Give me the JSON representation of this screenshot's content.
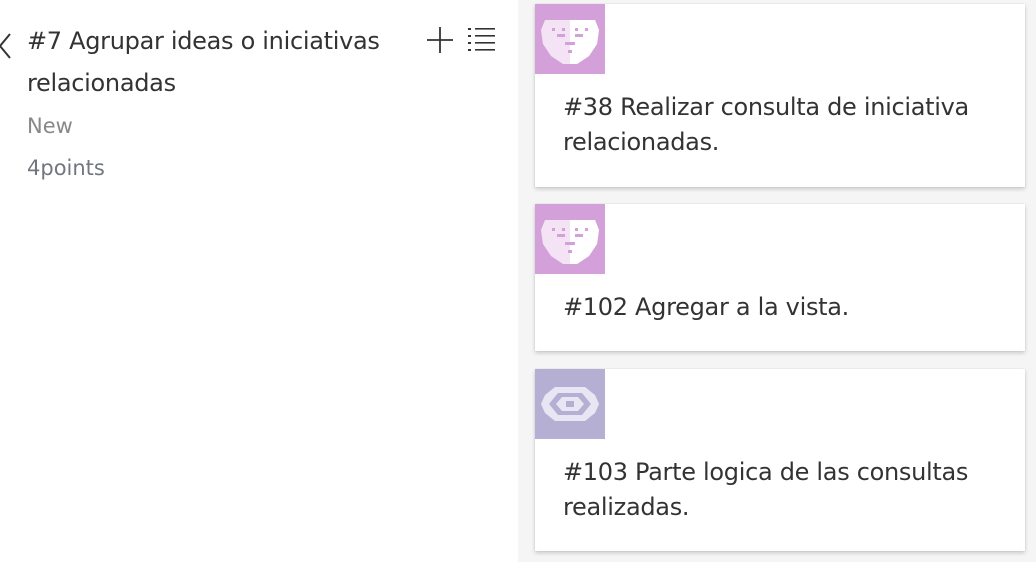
{
  "story": {
    "title": "#7 Agrupar ideas o iniciativas relacionadas",
    "state": "New",
    "points": "4points",
    "actions": {
      "collapse_icon": "chevron-left-icon",
      "add_icon": "plus-icon",
      "list_icon": "list-icon"
    }
  },
  "tasks": [
    {
      "title": "#38 Realizar consulta de iniciativa relacionadas.",
      "avatar_icon": "face-avatar-icon",
      "avatar_color": "#d4a0d9"
    },
    {
      "title": "#102 Agregar a la vista.",
      "avatar_icon": "face-avatar-icon",
      "avatar_color": "#d4a0d9"
    },
    {
      "title": "#103 Parte logica de las consultas realizadas.",
      "avatar_icon": "ring-avatar-icon",
      "avatar_color": "#b5b0d3"
    }
  ],
  "colors": {
    "text": "#333333",
    "muted": "#888888",
    "panel_bg": "#f5f5f5"
  }
}
